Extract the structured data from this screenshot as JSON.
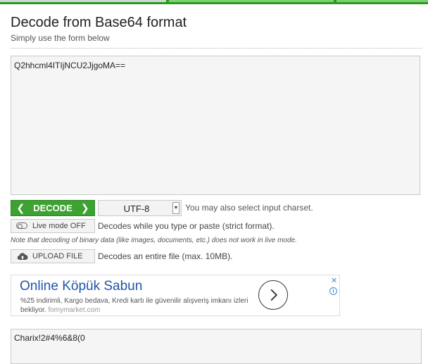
{
  "header": {
    "title": "Decode from Base64 format",
    "subtitle": "Simply use the form below"
  },
  "input": {
    "value": "Q2hhcml4ITIjNCU2JjgoMA=="
  },
  "controls": {
    "decode_label": "DECODE",
    "charset_value": "UTF-8",
    "charset_note": "You may also select input charset.",
    "live_mode_label": "Live mode OFF",
    "live_mode_note": "Decodes while you type or paste (strict format).",
    "binary_note": "Note that decoding of binary data (like images, documents, etc.) does not work in live mode.",
    "upload_label": "UPLOAD FILE",
    "upload_note": "Decodes an entire file (max. 10MB)."
  },
  "ad": {
    "title": "Online Köpük Sabun",
    "description": "%25 indirimli, Kargo bedava, Kredi kartı ile güvenilir alışveriş imkanı izleri bekliyor.",
    "domain": "fomymarket.com"
  },
  "output": {
    "value": "Charix!2#4%6&8(0"
  },
  "colors": {
    "brand_green": "#3da232",
    "ad_blue": "#2255a8"
  }
}
